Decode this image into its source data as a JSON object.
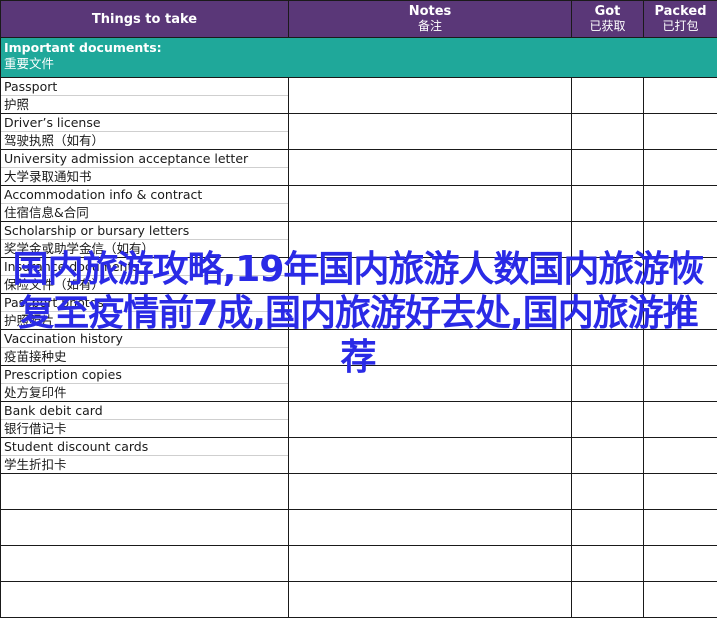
{
  "header": {
    "col_item": "Things to take",
    "col_notes_en": "Notes",
    "col_notes_zh": "备注",
    "col_got_en": "Got",
    "col_got_zh": "已获取",
    "col_packed_en": "Packed",
    "col_packed_zh": "已打包"
  },
  "section": {
    "title_en": "Important documents:",
    "title_zh": "重要文件"
  },
  "items": [
    {
      "en": "Passport",
      "zh": "护照"
    },
    {
      "en": "Driver’s license",
      "zh": "驾驶执照（如有）"
    },
    {
      "en": "University admission acceptance letter",
      "zh": "大学录取通知书"
    },
    {
      "en": "Accommodation info & contract",
      "zh": "住宿信息&合同"
    },
    {
      "en": "Scholarship or bursary letters",
      "zh": "奖学金或助学金信（如有）"
    },
    {
      "en": "Insurance documents",
      "zh": "保险文件（如有）"
    },
    {
      "en": "Passport photos",
      "zh": "护照照片"
    },
    {
      "en": "Vaccination history",
      "zh": "疫苗接种史"
    },
    {
      "en": "Prescription copies",
      "zh": "处方复印件"
    },
    {
      "en": "Bank debit card",
      "zh": "银行借记卡"
    },
    {
      "en": "Student discount cards",
      "zh": "学生折扣卡"
    }
  ],
  "overlay_text": "国内旅游攻略,19年国内旅游人数国内旅游恢复至疫情前7成,国内旅游好去处,国内旅游推荐",
  "colors": {
    "header_bg": "#5a3778",
    "section_bg": "#1fa89a",
    "overlay": "#2a2ae6"
  }
}
